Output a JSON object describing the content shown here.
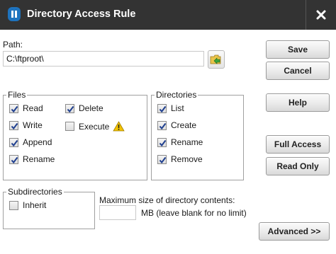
{
  "window": {
    "title": "Directory Access Rule",
    "close_label": "✕"
  },
  "path": {
    "label": "Path:",
    "value": "C:\\ftproot\\"
  },
  "files": {
    "legend": "Files",
    "read": "Read",
    "write": "Write",
    "append": "Append",
    "rename": "Rename",
    "delete": "Delete",
    "execute": "Execute"
  },
  "directories": {
    "legend": "Directories",
    "list": "List",
    "create": "Create",
    "rename": "Rename",
    "remove": "Remove"
  },
  "subdirectories": {
    "legend": "Subdirectories",
    "inherit": "Inherit"
  },
  "max_size": {
    "label": "Maximum size of directory contents:",
    "value": "",
    "unit_note": "MB (leave blank for no limit)"
  },
  "buttons": {
    "save": "Save",
    "cancel": "Cancel",
    "help": "Help",
    "full_access": "Full Access",
    "read_only": "Read Only",
    "advanced": "Advanced >>"
  },
  "colors": {
    "titlebar": "#333333",
    "app_icon": "#1e73be",
    "warning": "#f2c200",
    "checkmark": "#1f3f8f"
  },
  "icons": {
    "app": "app-logo-icon",
    "close": "close-icon",
    "browse": "folder-browse-icon",
    "warning": "warning-icon"
  }
}
